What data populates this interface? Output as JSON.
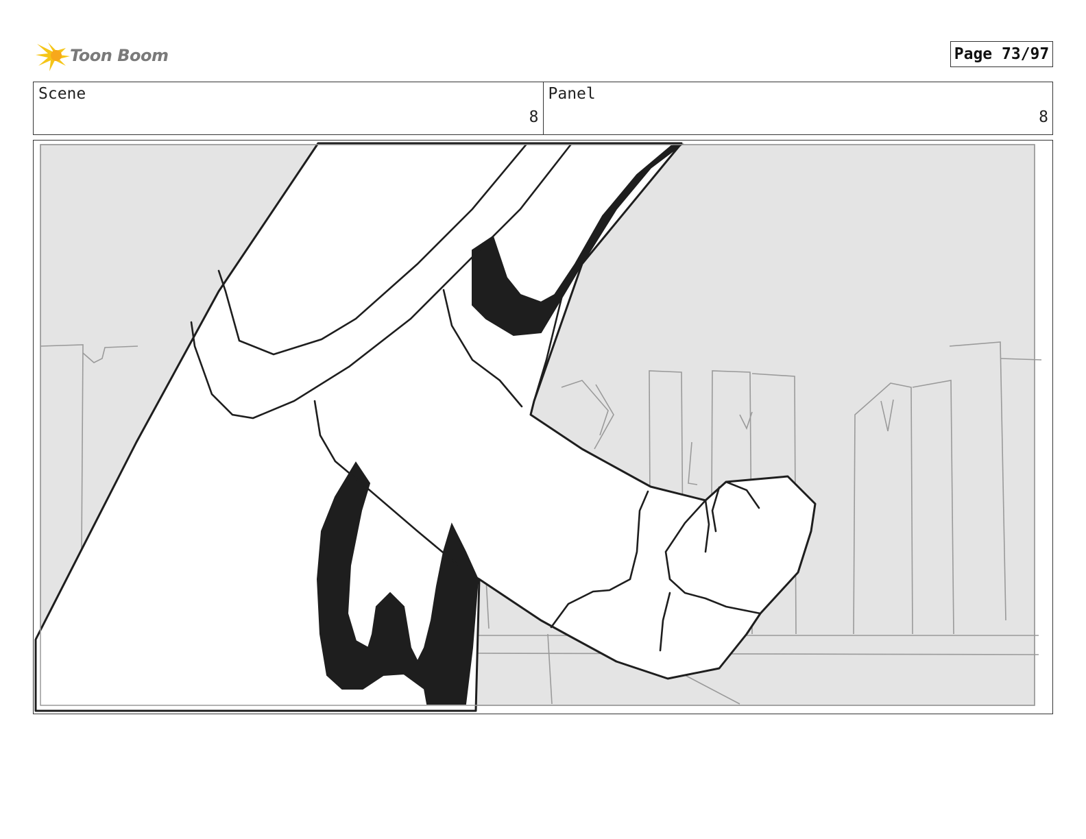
{
  "brand": {
    "logo_text": "Toon Boom",
    "accent": "#f5c518"
  },
  "page": {
    "label": "Page 73/97"
  },
  "scene": {
    "label": "Scene",
    "value": "8"
  },
  "panel": {
    "label": "Panel",
    "value": "8"
  },
  "drawing": {
    "background": "#e4e4e4",
    "ink": "#1e1e1e"
  }
}
